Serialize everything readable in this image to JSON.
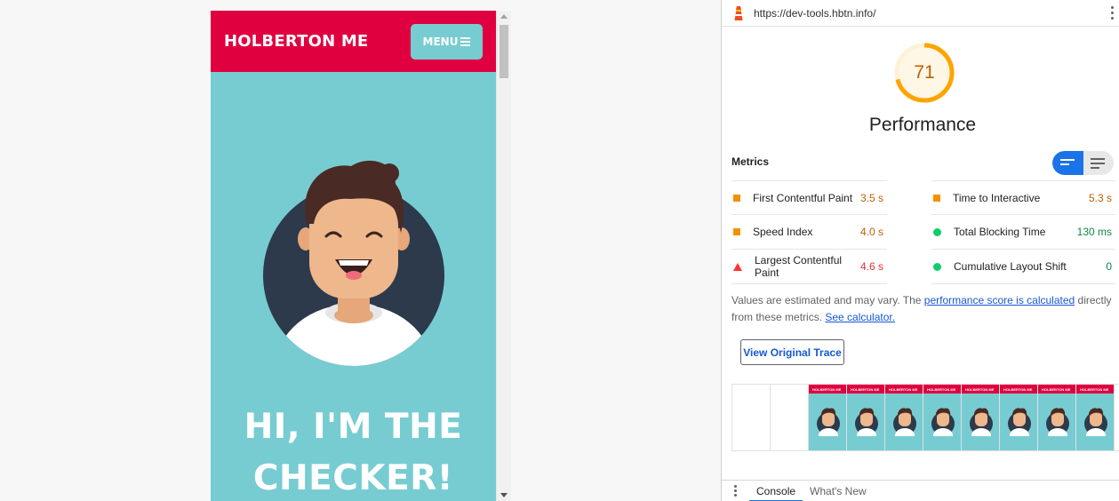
{
  "preview": {
    "brand": "HOLBERTON ME",
    "menu_label": "MENU",
    "hero_line1": "HI, I'M THE",
    "hero_line2": "CHECKER!",
    "colors": {
      "header": "#e0003f",
      "body": "#77ccd2"
    }
  },
  "devtools": {
    "url": "https://dev-tools.hbtn.info/",
    "score": "71",
    "score_fraction": 0.71,
    "category": "Performance",
    "metrics_title": "Metrics",
    "metrics_left": [
      {
        "name": "First Contentful Paint",
        "value": "3.5 s",
        "status": "average"
      },
      {
        "name": "Speed Index",
        "value": "4.0 s",
        "status": "average"
      },
      {
        "name": "Largest Contentful Paint",
        "value": "4.6 s",
        "status": "fail"
      }
    ],
    "metrics_right": [
      {
        "name": "Time to Interactive",
        "value": "5.3 s",
        "status": "average"
      },
      {
        "name": "Total Blocking Time",
        "value": "130 ms",
        "status": "pass"
      },
      {
        "name": "Cumulative Layout Shift",
        "value": "0",
        "status": "pass"
      }
    ],
    "note_text1": "Values are estimated and may vary. The ",
    "note_link1": "performance score is calculated",
    "note_text2": " directly from these metrics. ",
    "note_link2": "See calculator.",
    "trace_button": "View Original Trace",
    "filmstrip_label": "HOLBERTON ME",
    "drawer_tabs": [
      "Console",
      "What's New"
    ],
    "colors": {
      "average": "#c35f00",
      "fail": "#e03131",
      "pass": "#0a8a45",
      "accent": "#1a73e8"
    }
  }
}
